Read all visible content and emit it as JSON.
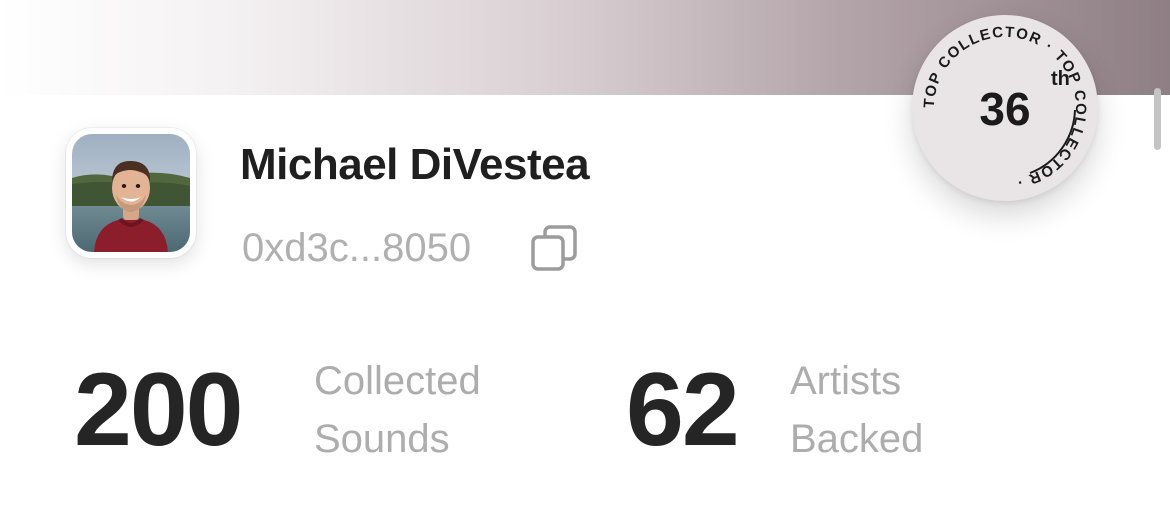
{
  "profile": {
    "name": "Michael DiVestea",
    "address": "0xd3c...8050"
  },
  "badge": {
    "ring_text": "TOP COLLECTOR · TOP COLLECTOR ·",
    "rank_number": "36",
    "rank_suffix": "th"
  },
  "stats": [
    {
      "value": "200",
      "label_line1": "Collected",
      "label_line2": "Sounds"
    },
    {
      "value": "62",
      "label_line1": "Artists",
      "label_line2": "Backed"
    }
  ],
  "icons": {
    "copy": "copy-icon",
    "avatar": "profile-photo"
  },
  "colors": {
    "text_primary": "#1f1f1f",
    "text_secondary": "#adadad",
    "badge_background": "#e9e5e6",
    "banner_end": "#8e7f84"
  }
}
